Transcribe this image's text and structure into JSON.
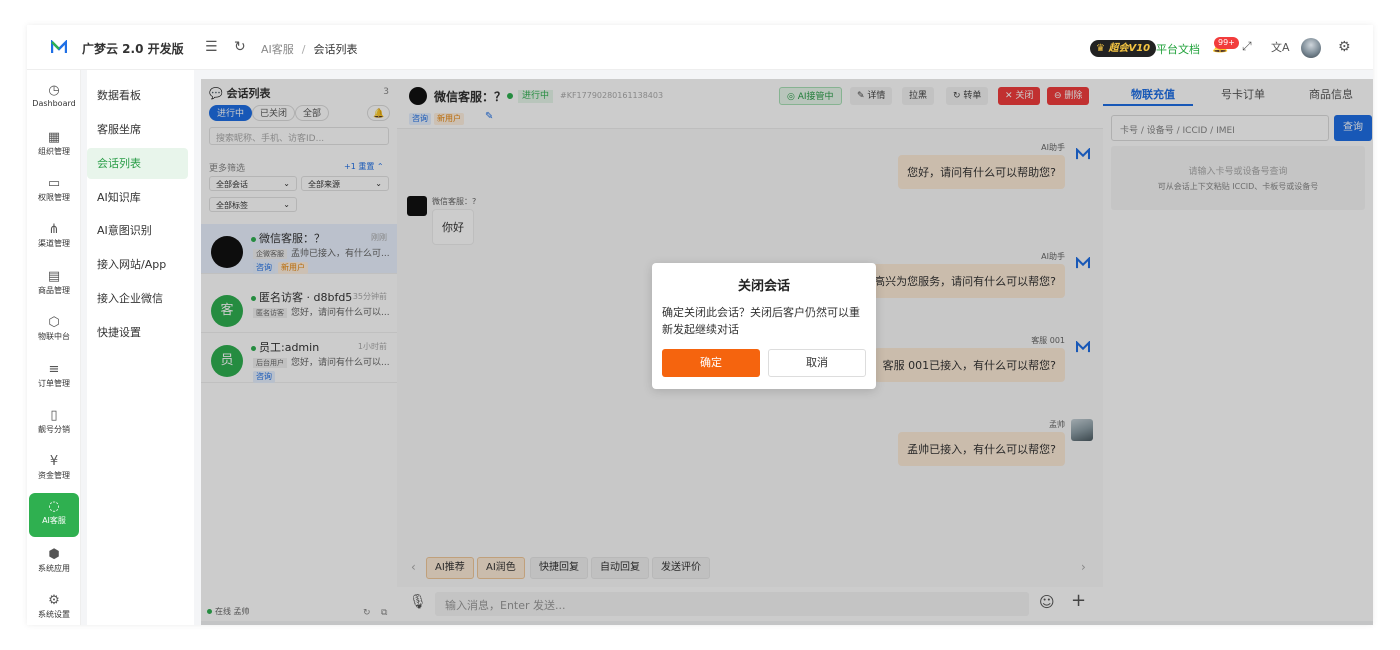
{
  "app": {
    "name": "广梦云 2.0 开发版"
  },
  "breadcrumb": {
    "parent": "AI客服",
    "sep": "/",
    "current": "会话列表"
  },
  "topbar": {
    "vip": "超会V10",
    "docs": "平台文档",
    "notify_badge": "99+"
  },
  "rail": [
    {
      "label": "Dashboard",
      "icon": "dashboard-icon"
    },
    {
      "label": "组织管理",
      "icon": "grid-icon"
    },
    {
      "label": "权限管理",
      "icon": "monitor-icon"
    },
    {
      "label": "渠道管理",
      "icon": "network-icon"
    },
    {
      "label": "商品管理",
      "icon": "store-icon"
    },
    {
      "label": "物联中台",
      "icon": "cube-icon"
    },
    {
      "label": "订单管理",
      "icon": "list-icon"
    },
    {
      "label": "靓号分销",
      "icon": "phone-icon"
    },
    {
      "label": "资金管理",
      "icon": "yen-icon"
    },
    {
      "label": "AI客服",
      "icon": "chat-icon"
    },
    {
      "label": "系统应用",
      "icon": "box-icon"
    },
    {
      "label": "系统设置",
      "icon": "gear-icon"
    }
  ],
  "submenu": [
    "数据看板",
    "客服坐席",
    "会话列表",
    "AI知识库",
    "AI意图识别",
    "接入网站/App",
    "接入企业微信",
    "快捷设置"
  ],
  "conv_panel": {
    "title": "会话列表",
    "count": "3",
    "filters": [
      "进行中",
      "已关闭",
      "全部"
    ],
    "search_placeholder": "搜索昵称、手机、访客ID...",
    "more": "更多筛选",
    "plus": "+1",
    "reset": "重置",
    "selects": [
      "全部会话",
      "全部来源",
      "全部标签"
    ],
    "items": [
      {
        "name": "微信客服：？",
        "time": "刚刚",
        "source": "企微客服",
        "preview": "孟帅已接入，有什么可...",
        "tags": [
          "咨询",
          "新用户"
        ],
        "avatar": ""
      },
      {
        "name": "匿名访客 · d8bfd5",
        "time": "35分钟前",
        "source": "匿名访客",
        "preview": "您好，请问有什么可以...",
        "tags": [],
        "avatar": "客"
      },
      {
        "name": "员工:admin",
        "time": "1小时前",
        "source": "后台用户",
        "preview": "您好，请问有什么可以...",
        "tags": [
          "咨询"
        ],
        "avatar": "员"
      }
    ],
    "footer_status": "在线",
    "footer_user": "孟帅"
  },
  "chat": {
    "name": "微信客服：？",
    "status": "进行中",
    "id": "#KF17790280161138403",
    "tags": [
      "咨询",
      "新用户"
    ],
    "buttons": [
      "AI接管中",
      "详情",
      "拉黑",
      "转单",
      "关闭",
      "删除"
    ],
    "messages": [
      {
        "sender": "AI助手",
        "text": "您好，请问有什么可以帮助您?"
      },
      {
        "sender": "微信客服：?",
        "text": "你好"
      },
      {
        "sender": "AI助手",
        "text": "您好，很高兴为您服务，请问有什么可以帮您?"
      },
      {
        "sender": "客服 001",
        "text": "客服 001已接入，有什么可以帮您?"
      },
      {
        "sender": "孟帅",
        "text": "孟帅已接入，有什么可以帮您?"
      }
    ],
    "quick": [
      "AI推荐",
      "AI润色",
      "快捷回复",
      "自动回复",
      "发送评价"
    ],
    "input_placeholder": "输入消息，Enter 发送..."
  },
  "right_panel": {
    "tabs": [
      "物联充值",
      "号卡订单",
      "商品信息"
    ],
    "input_placeholder": "卡号 / 设备号 / ICCID / IMEI",
    "button": "查询",
    "empty_line1": "请输入卡号或设备号查询",
    "empty_line2": "可从会话上下文粘贴 ICCID、卡板号或设备号"
  },
  "modal": {
    "title": "关闭会话",
    "body": "确定关闭此会话？关闭后客户仍然可以重新发起继续对话",
    "confirm": "确定",
    "cancel": "取消"
  },
  "colors": {
    "brand_green": "#2fb050",
    "primary_blue": "#1f6fe5",
    "confirm_orange": "#f5640e",
    "danger_red": "#f23c3c"
  }
}
